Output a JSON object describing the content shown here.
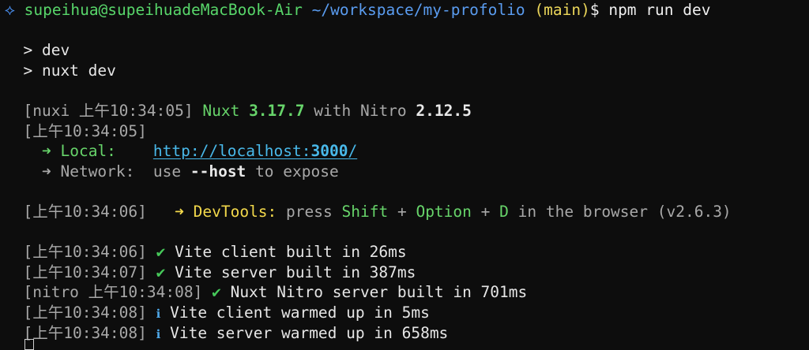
{
  "prompt": {
    "icon": "⟡",
    "user_host": "supeihua@supeihuadeMacBook-Air",
    "path": "~/workspace/my-profolio",
    "branch": "(main)",
    "symbol": "$",
    "command": "npm run dev"
  },
  "script_lines": [
    "> dev",
    "> nuxt dev"
  ],
  "nuxi_header": {
    "prefix": "[nuxi 上午10:34:05]",
    "name": "Nuxt",
    "version": "3.17.7",
    "with": "with Nitro",
    "nitro_version": "2.12.5"
  },
  "timestamp_line": "[上午10:34:05]",
  "local": {
    "arrow": "➜",
    "label": "Local:",
    "url_prefix": "http://localhost:",
    "port": "3000",
    "url_suffix": "/"
  },
  "network": {
    "arrow": "➜",
    "label": "Network:",
    "text_pre": "use",
    "flag": "--host",
    "text_post": "to expose"
  },
  "devtools": {
    "timestamp": "[上午10:34:06]",
    "arrow": "➜",
    "label": "DevTools:",
    "press": "press",
    "key1": "Shift",
    "plus1": "+",
    "key2": "Option",
    "plus2": "+",
    "key3": "D",
    "tail": "in the browser (v2.6.3)"
  },
  "build_lines": [
    {
      "prefix": "[上午10:34:06]",
      "icon": "✔",
      "text": "Vite client built in 26ms"
    },
    {
      "prefix": "[上午10:34:07]",
      "icon": "✔",
      "text": "Vite server built in 387ms"
    },
    {
      "prefix": "[nitro 上午10:34:08]",
      "icon": "✔",
      "text": "Nuxt Nitro server built in 701ms"
    },
    {
      "prefix": "[上午10:34:08]",
      "icon": "ℹ",
      "text": "Vite client warmed up in 5ms"
    },
    {
      "prefix": "[上午10:34:08]",
      "icon": "ℹ",
      "text": "Vite server warmed up in 658ms"
    }
  ],
  "colors": {
    "background": "#0d0d0d",
    "prompt_user": "#58d66a",
    "prompt_path": "#5a9cf0",
    "prompt_branch": "#ecd75a",
    "success": "#67d46a",
    "link": "#49b9ea",
    "devtools": "#f2d84b"
  }
}
